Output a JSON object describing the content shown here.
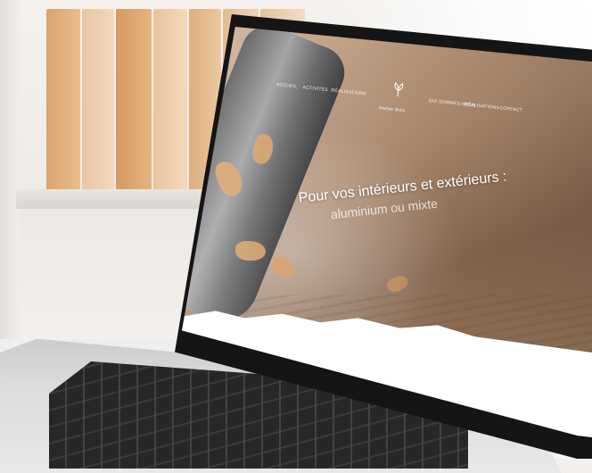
{
  "website": {
    "nav": {
      "items_left": [
        "Accueil",
        "Activités",
        "Réalisations"
      ],
      "logo_text": "Atelier Bois",
      "items_right": [
        "Qui sommes-nous",
        "Réalisations",
        "Contact"
      ]
    },
    "hero": {
      "line1": "Pour vos intérieurs et extérieurs :",
      "line2": "aluminium ou mixte"
    }
  },
  "colors": {
    "screen_text": "#ffffff",
    "bezel": "#151515",
    "wood": "#b18d70"
  }
}
